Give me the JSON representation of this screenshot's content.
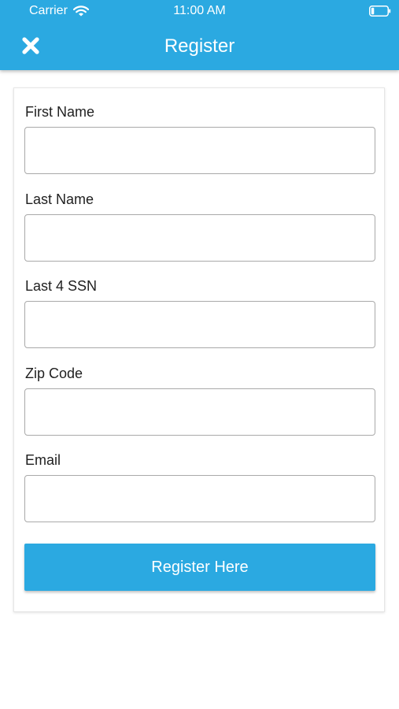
{
  "status_bar": {
    "carrier": "Carrier",
    "time": "11:00 AM",
    "wifi_icon": "wifi-icon",
    "battery_icon": "battery-icon"
  },
  "header": {
    "title": "Register",
    "close_icon": "close-icon",
    "background_color": "#2ba9e1"
  },
  "form": {
    "fields": [
      {
        "label": "First Name",
        "value": "",
        "placeholder": ""
      },
      {
        "label": "Last Name",
        "value": "",
        "placeholder": ""
      },
      {
        "label": "Last 4 SSN",
        "value": "",
        "placeholder": ""
      },
      {
        "label": "Zip Code",
        "value": "",
        "placeholder": ""
      },
      {
        "label": "Email",
        "value": "",
        "placeholder": ""
      }
    ],
    "submit_label": "Register Here",
    "submit_color": "#2ba9e1"
  }
}
